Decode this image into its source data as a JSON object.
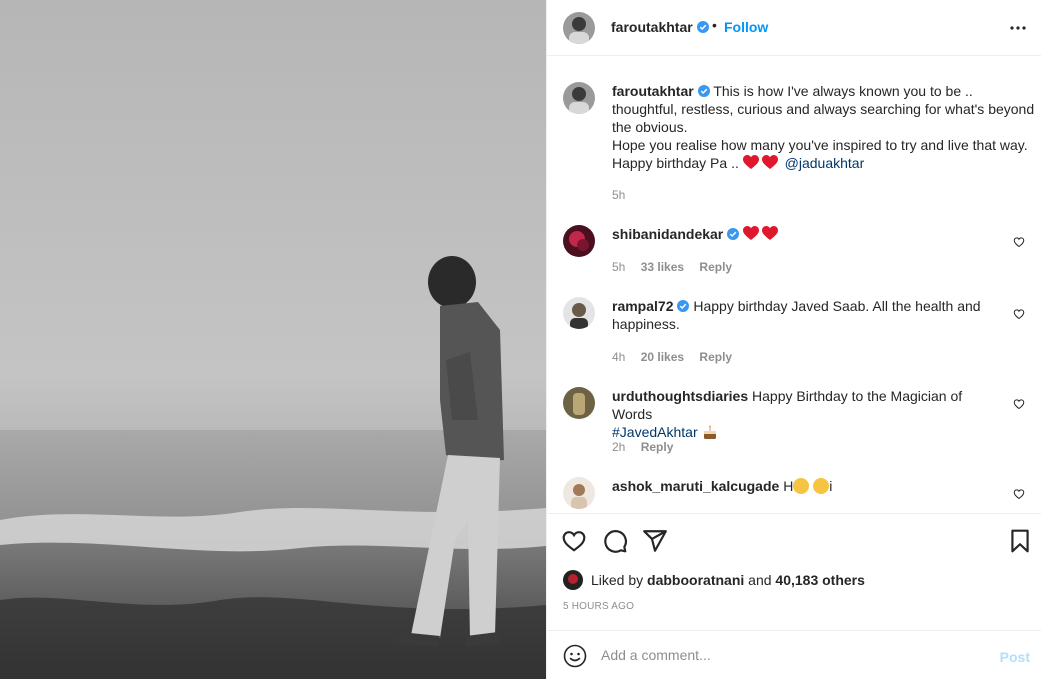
{
  "header": {
    "username": "faroutakhtar",
    "dot": "•",
    "follow_label": "Follow"
  },
  "caption": {
    "username": "faroutakhtar",
    "text_line1": "This is how I've always known you to be ..",
    "text_line2": "thoughtful, restless, curious and always searching for what's beyond",
    "text_line3": "the obvious.",
    "text_line4": "Hope you realise how many you've inspired to try and live that way.",
    "text_line5": "Happy birthday Pa ..",
    "mention": "@jaduakhtar",
    "time": "5h"
  },
  "comments": [
    {
      "username": "shibanidandekar",
      "verified": true,
      "text": "",
      "time": "5h",
      "likes": "33 likes",
      "reply": "Reply"
    },
    {
      "username": "rampal72",
      "verified": true,
      "text_line1": "Happy birthday Javed Saab. All the health and",
      "text_line2": "happiness.",
      "time": "4h",
      "likes": "20 likes",
      "reply": "Reply"
    },
    {
      "username": "urduthoughtsdiaries",
      "verified": false,
      "text_line1": "Happy Birthday to the Magician of Words",
      "hashtag": "#JavedAkhtar",
      "time": "2h",
      "reply": "Reply"
    },
    {
      "username": "ashok_maruti_kalcugade",
      "verified": false,
      "text_prefix": "H",
      "text_suffix": "i"
    }
  ],
  "likes": {
    "prefix": "Liked by",
    "user": "dabbooratnani",
    "and": "and",
    "others": "40,183 others"
  },
  "time_ago": "5 HOURS AGO",
  "add_comment": {
    "placeholder": "Add a comment...",
    "post_label": "Post"
  },
  "colors": {
    "accent": "#0095f6",
    "verified": "#3897f0",
    "heart": "#ed4956",
    "muted": "#8e8e8e",
    "post_disabled": "#b2dffc"
  },
  "icons": [
    "more-icon",
    "verified-icon",
    "heart-outline-icon",
    "comment-icon",
    "share-icon",
    "bookmark-icon",
    "smile-icon",
    "red-heart-emoji",
    "cake-emoji",
    "face-emoji"
  ]
}
